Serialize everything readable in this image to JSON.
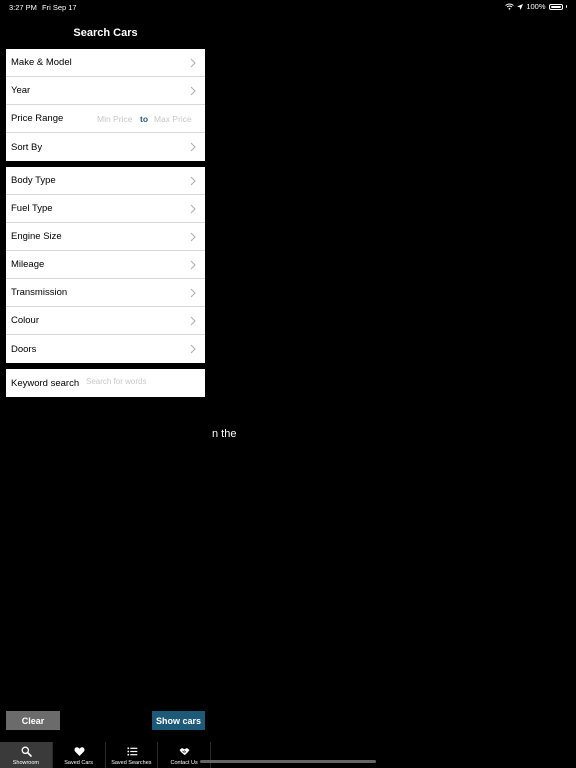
{
  "status_bar": {
    "time": "3:27 PM",
    "date": "Fri Sep 17",
    "battery": "100%"
  },
  "header": {
    "title": "Search Cars"
  },
  "group1": {
    "make_model": "Make & Model",
    "year": "Year",
    "price_range": {
      "label": "Price Range",
      "min_placeholder": "Min Price",
      "separator": "to",
      "max_placeholder": "Max Price"
    },
    "sort_by": "Sort By"
  },
  "group2": {
    "items": [
      "Body Type",
      "Fuel Type",
      "Engine Size",
      "Mileage",
      "Transmission",
      "Colour",
      "Doors"
    ]
  },
  "keyword": {
    "label": "Keyword search",
    "placeholder": "Search for words",
    "value": ""
  },
  "background_text": "n the",
  "buttons": {
    "clear": "Clear",
    "show": "Show cars"
  },
  "tabs": [
    {
      "label": "Showroom",
      "icon": "search-icon",
      "active": true
    },
    {
      "label": "Saved Cars",
      "icon": "heart-icon",
      "active": false
    },
    {
      "label": "Saved Searches",
      "icon": "list-icon",
      "active": false
    },
    {
      "label": "Contact Us",
      "icon": "handshake-icon",
      "active": false
    }
  ],
  "colors": {
    "accent": "#1d5a78",
    "clear_button": "#6b6b6b",
    "to_text": "#2b5e80"
  }
}
